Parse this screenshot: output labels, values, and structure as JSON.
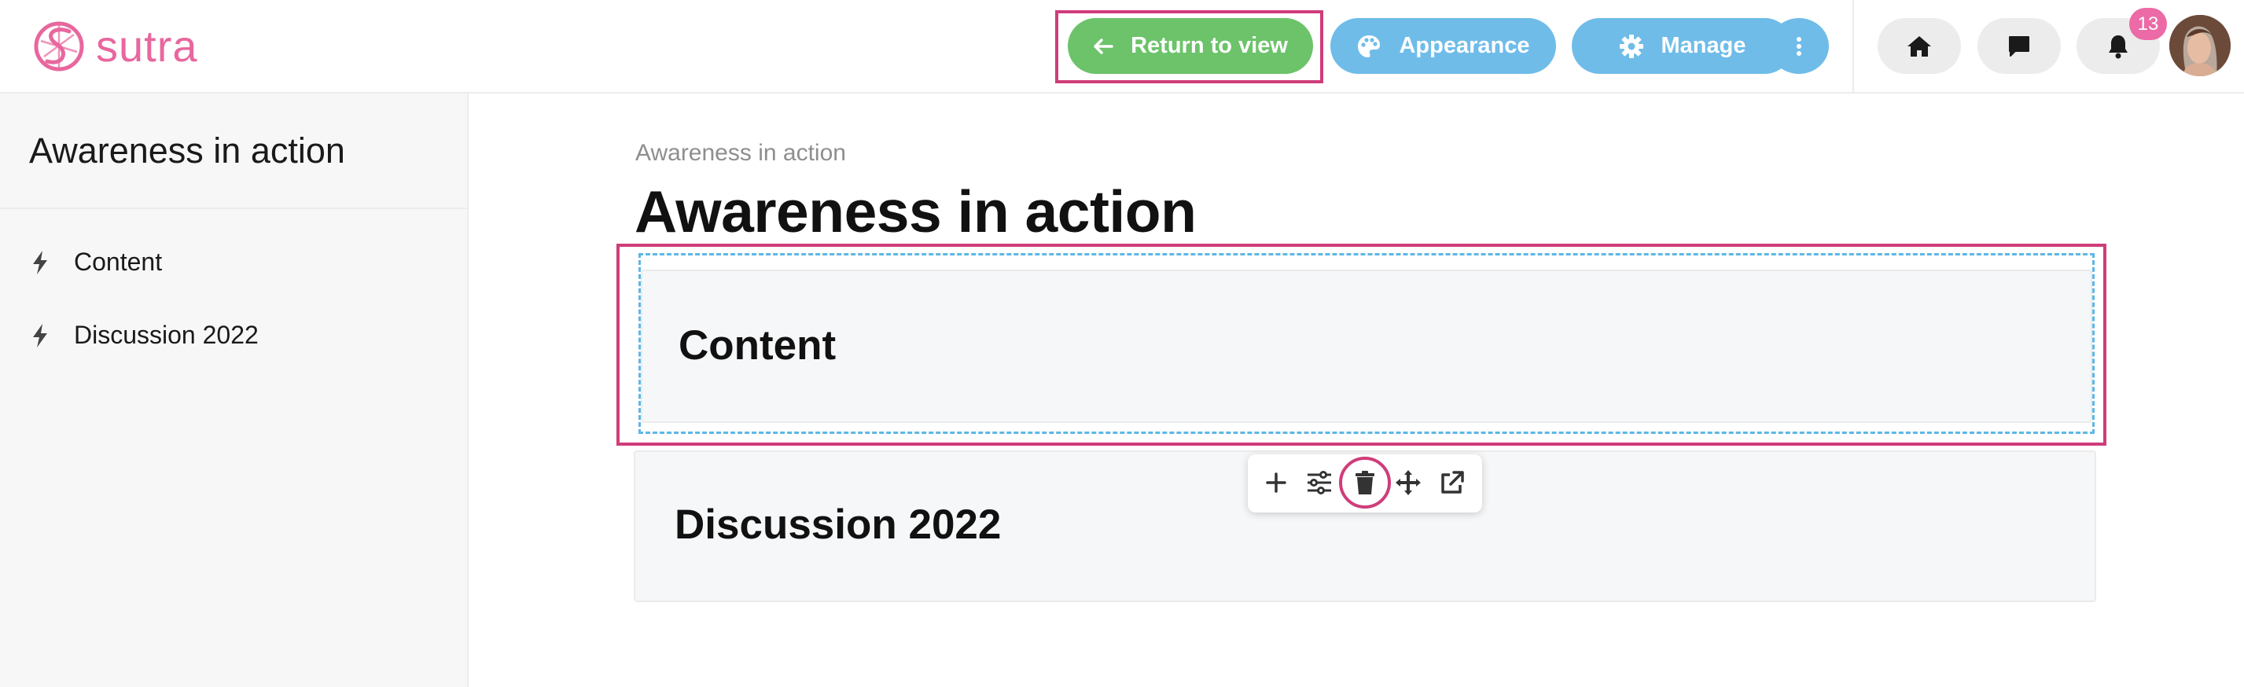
{
  "app": {
    "logo_text": "sutra",
    "brand_color": "#e8679e"
  },
  "header": {
    "return_label": "Return to view",
    "appearance_label": "Appearance",
    "manage_label": "Manage",
    "notification_count": "13",
    "colors": {
      "return": "#6cc36a",
      "action": "#6fbce9",
      "highlight": "#cf3d7a"
    }
  },
  "sidebar": {
    "title": "Awareness in action",
    "items": [
      {
        "label": "Content",
        "icon": "bolt-icon"
      },
      {
        "label": "Discussion 2022",
        "icon": "bolt-icon"
      }
    ]
  },
  "main": {
    "breadcrumb": "Awareness in action",
    "title": "Awareness in action",
    "blocks": [
      {
        "title": "Content"
      },
      {
        "title": "Discussion 2022"
      }
    ]
  },
  "block_toolbar": {
    "icons": [
      "plus-icon",
      "sliders-icon",
      "trash-icon",
      "move-icon",
      "external-link-icon"
    ]
  }
}
